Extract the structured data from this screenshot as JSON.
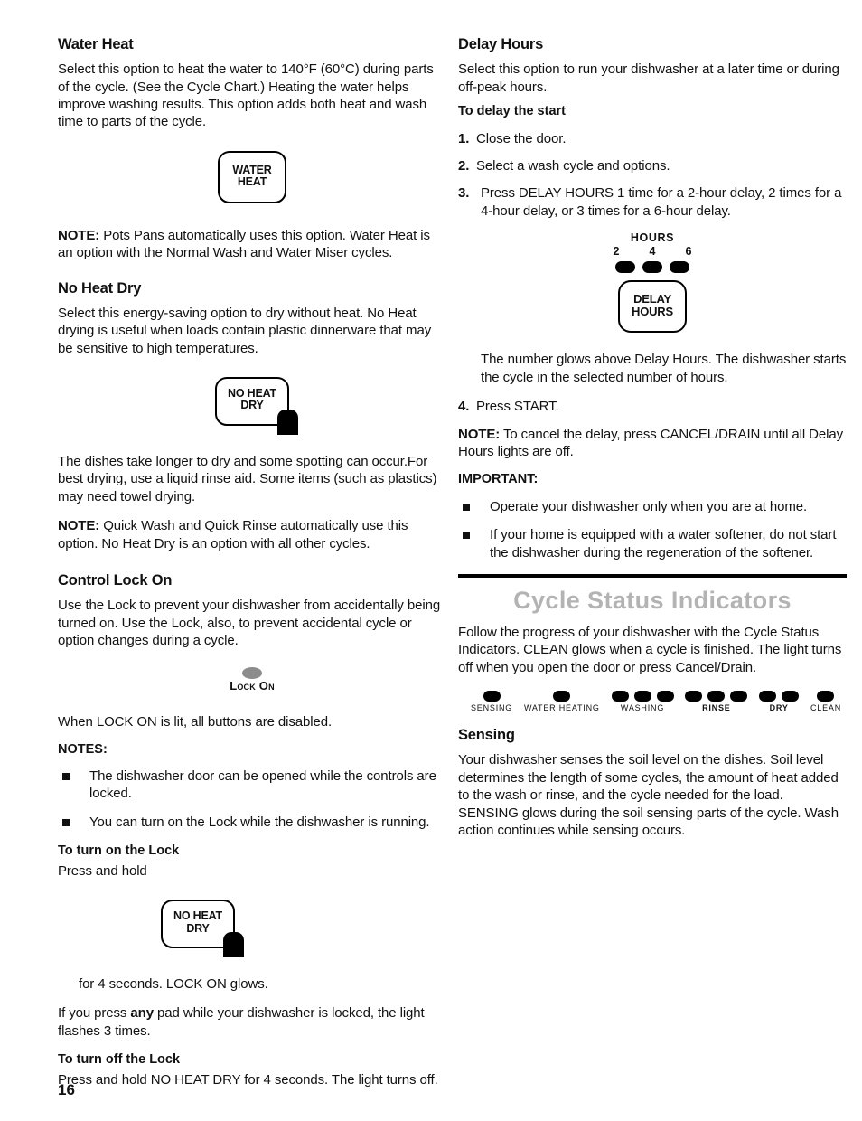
{
  "page_number": "16",
  "left_column": {
    "water_heat": {
      "heading": "Water Heat",
      "body": "Select this option to heat the water to 140°F (60°C) during parts of the cycle. (See the Cycle Chart.) Heating the water helps improve washing results. This option adds both heat and wash time to parts of the cycle.",
      "button_line1": "WATER",
      "button_line2": "HEAT",
      "note_label": "NOTE:",
      "note_text": " Pots Pans automatically uses this option. Water Heat is an option with the Normal Wash and Water Miser cycles."
    },
    "no_heat_dry": {
      "heading": "No Heat Dry",
      "body": "Select this energy-saving option to dry without heat. No Heat drying is useful when loads contain plastic dinnerware that may be sensitive to high temperatures.",
      "button_line1": "NO HEAT",
      "button_line2": "DRY",
      "body2": "The dishes take longer to dry and some spotting can occur.For best drying, use a liquid rinse aid. Some items (such as plastics) may need towel drying.",
      "note_label": "NOTE:",
      "note_text": " Quick Wash and Quick Rinse automatically use this option. No Heat Dry is an option with all other cycles."
    },
    "control_lock": {
      "heading": "Control Lock On",
      "body": "Use the Lock to prevent your dishwasher from accidentally being turned on. Use the Lock, also, to prevent accidental cycle or option changes during a cycle.",
      "indicator_label": "Lock On",
      "body2": "When LOCK ON is lit, all buttons are disabled.",
      "notes_label": "NOTES:",
      "notes": [
        "The dishwasher door can be opened while the controls are locked.",
        "You can turn on the Lock while the dishwasher is running."
      ],
      "turn_on_heading": "To turn on the Lock",
      "turn_on_text": "Press and hold",
      "button_line1": "NO HEAT",
      "button_line2": "DRY",
      "after_button_text": "for 4 seconds. LOCK ON glows.",
      "body3_part1": "If you press ",
      "body3_bold": "any",
      "body3_part2": " pad while your dishwasher is locked, the light flashes 3 times.",
      "turn_off_heading": "To turn off the Lock",
      "turn_off_text": "Press and hold NO HEAT DRY for 4 seconds. The light turns off."
    }
  },
  "right_column": {
    "delay_hours": {
      "heading": "Delay Hours",
      "body": "Select this option to run your dishwasher at a later time or during off-peak hours.",
      "sub_heading": "To delay the start",
      "steps": [
        {
          "num": "1.",
          "text": "Close the door."
        },
        {
          "num": "2.",
          "text": "Select a wash cycle and options."
        },
        {
          "num": "3.",
          "text": "Press DELAY HOURS 1 time for a 2-hour delay, 2 times for a 4-hour delay, or 3 times for a 6-hour delay."
        }
      ],
      "art": {
        "hours_label": "HOURS",
        "hour_numbers": [
          "2",
          "4",
          "6"
        ],
        "lamp_count": 3,
        "button_line1": "DELAY",
        "button_line2": "HOURS"
      },
      "after_art_text": "The number glows above Delay Hours. The dishwasher starts the cycle in the selected number of hours.",
      "step4": {
        "num": "4.",
        "text": "Press START."
      },
      "note_label": "NOTE:",
      "note_text": " To cancel the delay, press CANCEL/DRAIN until all Delay Hours lights are off.",
      "important_label": "IMPORTANT:",
      "important_items": [
        "Operate your dishwasher only when you are at home.",
        "If your home is equipped with a water softener, do not start the dishwasher during the regeneration of the softener."
      ]
    },
    "cycle_status": {
      "heading": "Cycle Status Indicators",
      "body": "Follow the progress of your dishwasher with the Cycle Status Indicators. CLEAN glows when a cycle is finished. The light turns off when you open the door or press Cancel/Drain.",
      "indicators": [
        {
          "label": "SENSING",
          "lamps": 1,
          "bold": false
        },
        {
          "label": "WATER HEATING",
          "lamps": 1,
          "bold": false
        },
        {
          "label": "WASHING",
          "lamps": 3,
          "bold": false
        },
        {
          "label": "RINSE",
          "lamps": 3,
          "bold": true
        },
        {
          "label": "DRY",
          "lamps": 2,
          "bold": true
        },
        {
          "label": "CLEAN",
          "lamps": 1,
          "bold": false
        }
      ]
    },
    "sensing": {
      "heading": "Sensing",
      "body": "Your dishwasher senses the soil level on the dishes. Soil level determines the length of some cycles, the amount of heat added to the wash or rinse, and the cycle needed for the load. SENSING glows during the soil sensing parts of the cycle. Wash action continues while sensing occurs."
    }
  }
}
